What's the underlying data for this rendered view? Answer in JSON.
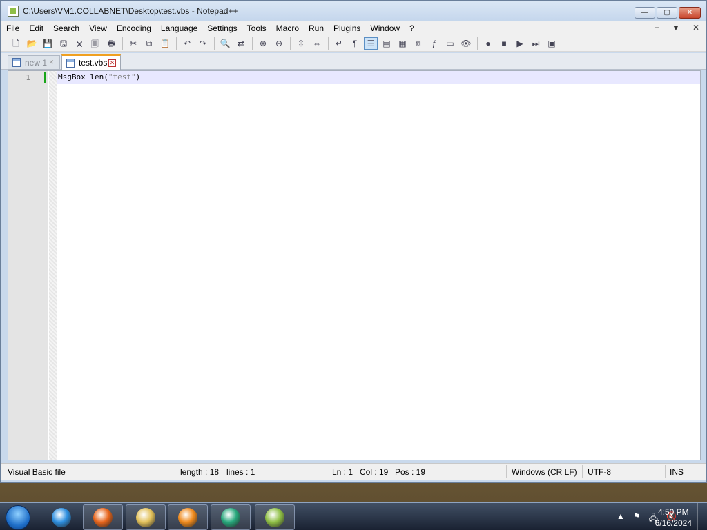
{
  "window": {
    "title": "C:\\Users\\VM1.COLLABNET\\Desktop\\test.vbs - Notepad++",
    "minimize_glyph": "—",
    "maximize_glyph": "▢",
    "close_glyph": "✕"
  },
  "menubar": {
    "items": [
      "File",
      "Edit",
      "Search",
      "View",
      "Encoding",
      "Language",
      "Settings",
      "Tools",
      "Macro",
      "Run",
      "Plugins",
      "Window",
      "?"
    ],
    "right": [
      "+",
      "▼",
      "✕"
    ]
  },
  "toolbar": {
    "icons": [
      {
        "name": "new-file-icon",
        "glyph": "🗋"
      },
      {
        "name": "open-file-icon",
        "glyph": "📂"
      },
      {
        "name": "save-icon",
        "glyph": "💾"
      },
      {
        "name": "save-all-icon",
        "glyph": "🖫"
      },
      {
        "name": "close-icon",
        "glyph": "🗙"
      },
      {
        "name": "close-all-icon",
        "glyph": "🗐"
      },
      {
        "name": "print-icon",
        "glyph": "🖶"
      },
      {
        "sep": true
      },
      {
        "name": "cut-icon",
        "glyph": "✂"
      },
      {
        "name": "copy-icon",
        "glyph": "⧉"
      },
      {
        "name": "paste-icon",
        "glyph": "📋"
      },
      {
        "sep": true
      },
      {
        "name": "undo-icon",
        "glyph": "↶"
      },
      {
        "name": "redo-icon",
        "glyph": "↷"
      },
      {
        "sep": true
      },
      {
        "name": "find-icon",
        "glyph": "🔍"
      },
      {
        "name": "replace-icon",
        "glyph": "⇄"
      },
      {
        "sep": true
      },
      {
        "name": "zoom-in-icon",
        "glyph": "⊕"
      },
      {
        "name": "zoom-out-icon",
        "glyph": "⊖"
      },
      {
        "sep": true
      },
      {
        "name": "sync-vertical-icon",
        "glyph": "⇳"
      },
      {
        "name": "sync-horizontal-icon",
        "glyph": "⇔"
      },
      {
        "sep": true
      },
      {
        "name": "word-wrap-icon",
        "glyph": "↵"
      },
      {
        "name": "show-all-chars-icon",
        "glyph": "¶"
      },
      {
        "name": "indent-guide-icon",
        "glyph": "☰",
        "active": true
      },
      {
        "name": "user-language-icon",
        "glyph": "▤"
      },
      {
        "name": "document-map-icon",
        "glyph": "▦"
      },
      {
        "name": "document-list-icon",
        "glyph": "⧈"
      },
      {
        "name": "function-list-icon",
        "glyph": "ƒ"
      },
      {
        "name": "folder-workspace-icon",
        "glyph": "▭"
      },
      {
        "name": "monitoring-icon",
        "glyph": "👁"
      },
      {
        "sep": true
      },
      {
        "name": "record-macro-icon",
        "glyph": "●"
      },
      {
        "name": "stop-recording-icon",
        "glyph": "■"
      },
      {
        "name": "playback-macro-icon",
        "glyph": "▶"
      },
      {
        "name": "run-macro-multiple-icon",
        "glyph": "⏭"
      },
      {
        "name": "save-macro-icon",
        "glyph": "▣"
      }
    ]
  },
  "tabs": [
    {
      "label": "new 1",
      "active": false
    },
    {
      "label": "test.vbs",
      "active": true
    }
  ],
  "editor": {
    "line_number": "1",
    "code_prefix": "MsgBox len(",
    "code_string": "\"test\"",
    "code_suffix": ")"
  },
  "statusbar": {
    "language": "Visual Basic file",
    "length": "length : 18",
    "lines": "lines : 1",
    "ln": "Ln : 1",
    "col": "Col : 19",
    "pos": "Pos : 19",
    "eol": "Windows (CR LF)",
    "encoding": "UTF-8",
    "mode": "INS"
  },
  "taskbar": {
    "time": "4:50 PM",
    "date": "6/16/2024",
    "tray_icons": [
      "▲",
      "⚑",
      "🖧",
      "🔇"
    ],
    "apps": [
      {
        "name": "internet-explorer-icon",
        "color": "#2d8fe0"
      },
      {
        "name": "firefox-icon",
        "color": "#e8651c"
      },
      {
        "name": "file-explorer-icon",
        "color": "#e2c15a"
      },
      {
        "name": "media-player-icon",
        "color": "#f08a1c"
      },
      {
        "name": "chat-app-icon",
        "color": "#27a87c"
      },
      {
        "name": "notepad-plus-plus-icon",
        "color": "#8fbf45"
      }
    ]
  }
}
